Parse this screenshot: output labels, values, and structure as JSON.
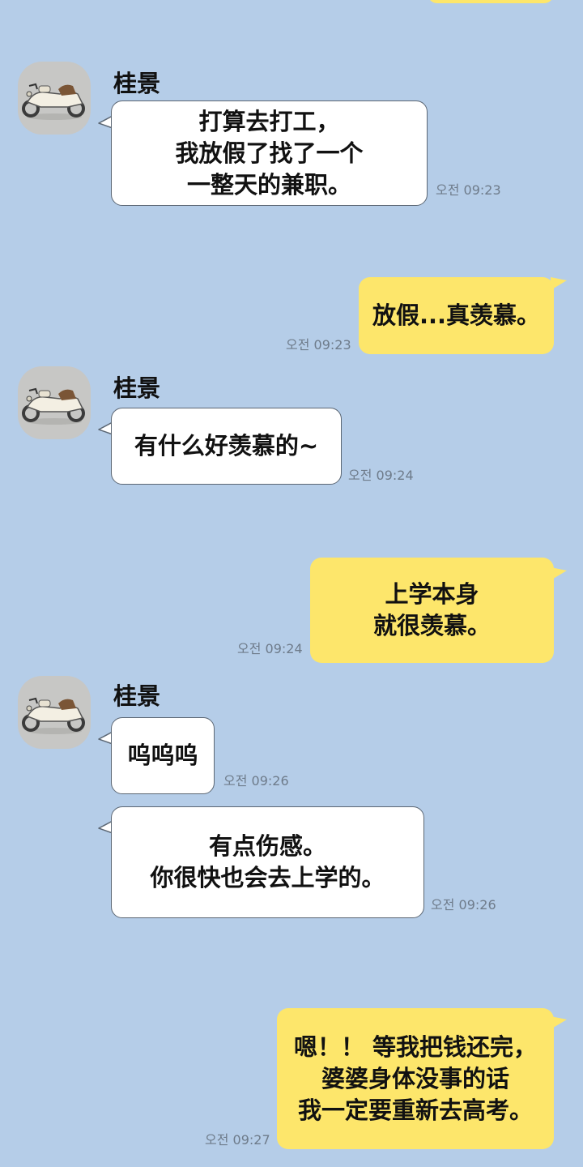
{
  "sender_name": "桂景",
  "avatar_icon": "motorcycle-sidecar-icon",
  "colors": {
    "background": "#b5cde8",
    "received_bubble": "#ffffff",
    "sent_bubble": "#fde66b"
  },
  "messages": [
    {
      "direction": "received",
      "show_name": true,
      "lines": [
        "打算去打工，",
        "我放假了找了一个",
        "一整天的兼职。"
      ],
      "time": "오전 09:23"
    },
    {
      "direction": "sent",
      "lines": [
        "放假...真羡慕。"
      ],
      "time": "오전 09:23"
    },
    {
      "direction": "received",
      "show_name": true,
      "lines": [
        "有什么好羡慕的~"
      ],
      "time": "오전 09:24"
    },
    {
      "direction": "sent",
      "lines": [
        "上学本身",
        "就很羡慕。"
      ],
      "time": "오전 09:24"
    },
    {
      "direction": "received",
      "show_name": true,
      "lines": [
        "呜呜呜"
      ],
      "time": "오전 09:26"
    },
    {
      "direction": "received",
      "show_name": false,
      "lines": [
        "有点伤感。",
        "你很快也会去上学的。"
      ],
      "time": "오전 09:26"
    },
    {
      "direction": "sent",
      "lines": [
        "嗯！！ 等我把钱还完，",
        "婆婆身体没事的话",
        "我一定要重新去高考。"
      ],
      "time": "오전 09:27"
    }
  ]
}
